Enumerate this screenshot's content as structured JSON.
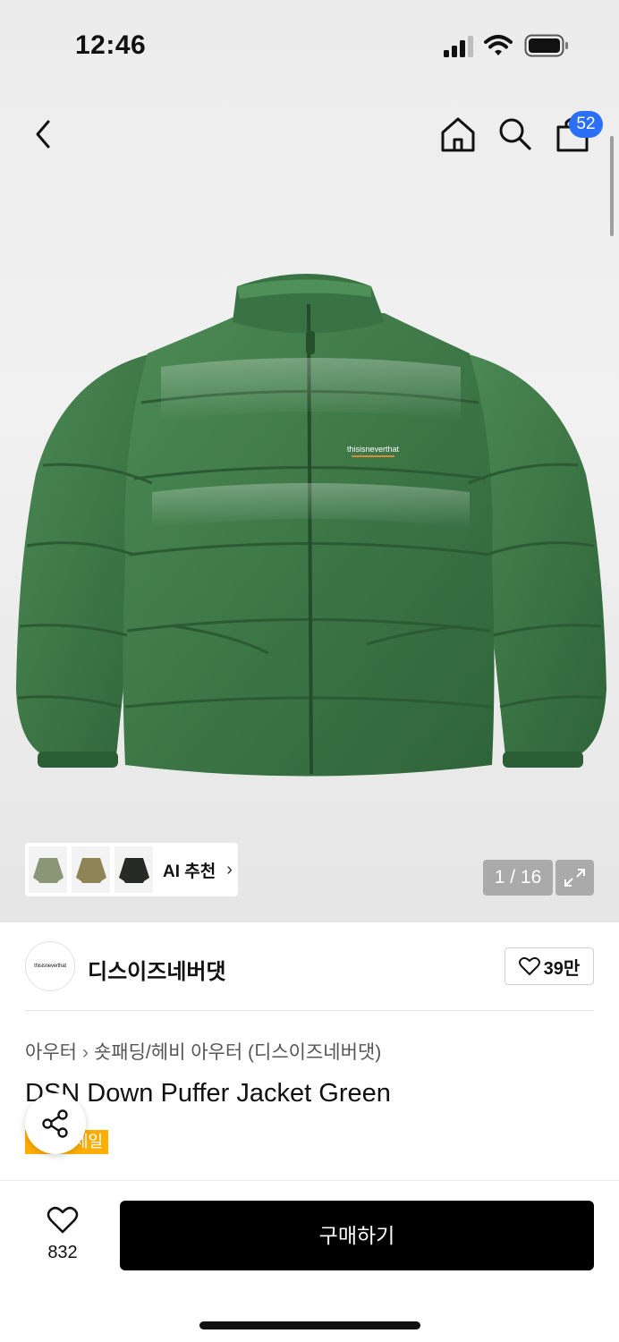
{
  "status_bar": {
    "time": "12:46"
  },
  "nav": {
    "back_icon": "chevron-left-icon",
    "home_icon": "home-icon",
    "search_icon": "search-icon",
    "cart_icon": "shopping-bag-icon",
    "cart_count": "52"
  },
  "gallery": {
    "ai_recommend_label": "AI 추천",
    "ai_thumbnails": [
      "olive-jacket",
      "khaki-jacket",
      "black-jacket"
    ],
    "page_counter": "1 / 16",
    "expand_icon": "expand-icon",
    "product_logo_text": "thisisneverthat"
  },
  "brand": {
    "logo_text": "thisisneverthat",
    "name": "디스이즈네버댓",
    "likes": "39만"
  },
  "breadcrumb": {
    "category": "아우터",
    "subcategory": "숏패딩/헤비 아우터 (디스이즈네버댓)"
  },
  "product": {
    "title": "DSN Down Puffer Jacket Green",
    "badge": "세일"
  },
  "bottom": {
    "wish_count": "832",
    "buy_label": "구매하기"
  },
  "colors": {
    "accent_blue": "#2a6ff6",
    "sale_orange": "#ffae00",
    "jacket_green": "#3f7a47",
    "buy_button": "#000000"
  }
}
